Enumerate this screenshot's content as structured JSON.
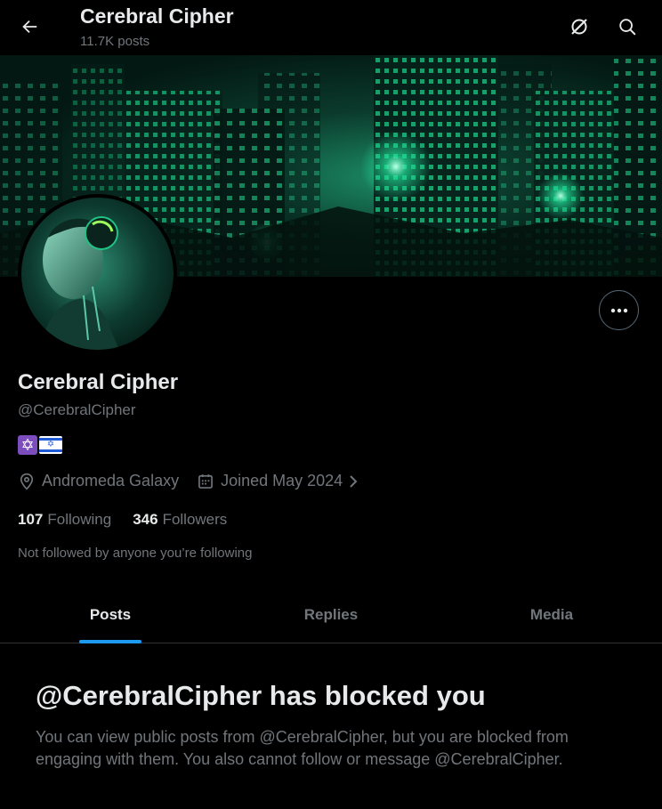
{
  "header": {
    "title": "Cerebral Cipher",
    "posts_count": "11.7K posts",
    "back_icon": "arrow-left-icon",
    "grok_icon": "grok-icon",
    "search_icon": "search-icon"
  },
  "profile": {
    "display_name": "Cerebral Cipher",
    "handle": "@CerebralCipher",
    "bio_emojis": [
      "✡️",
      "🇮🇱"
    ],
    "location": "Andromeda Galaxy",
    "joined": "Joined May 2024",
    "following_count": "107",
    "following_label": "Following",
    "followers_count": "346",
    "followers_label": "Followers",
    "not_followed_text": "Not followed by anyone you’re following"
  },
  "tabs": [
    {
      "label": "Posts",
      "active": true
    },
    {
      "label": "Replies",
      "active": false
    },
    {
      "label": "Media",
      "active": false
    }
  ],
  "blocked": {
    "title": "@CerebralCipher has blocked you",
    "description": "You can view public posts from @CerebralCipher, but you are blocked from engaging with them. You also cannot follow or message @CerebralCipher."
  },
  "colors": {
    "background": "#000000",
    "text_primary": "#e7e9ea",
    "text_secondary": "#71767b",
    "accent": "#1d9bf0",
    "banner_glow": "#22e39a"
  }
}
